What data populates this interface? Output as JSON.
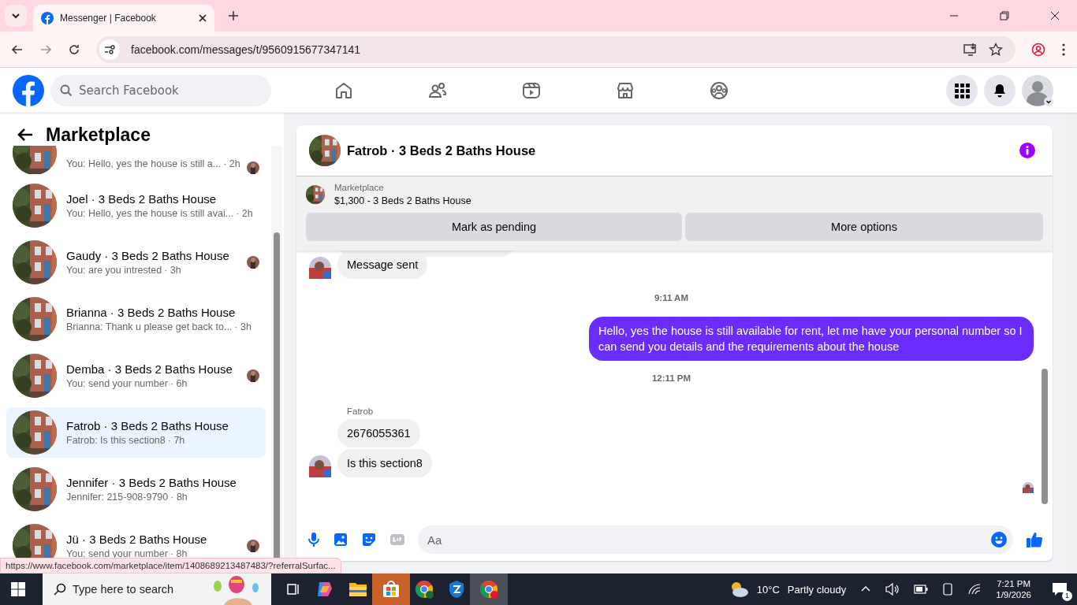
{
  "browser": {
    "tab_title": "Messenger | Facebook",
    "url": "facebook.com/messages/t/9560915677347141",
    "status_url": "https://www.facebook.com/marketplace/item/1408689213487483/?referralSurfac..."
  },
  "topbar": {
    "search": {
      "placeholder": "Search Facebook"
    }
  },
  "sidebar": {
    "title": "Marketplace",
    "conversations": [
      {
        "kind": "partial",
        "preview": "You: Hello, yes the house is still a...",
        "time": "· 2h",
        "selected": false,
        "seen_avatar": true
      },
      {
        "kind": "full",
        "name": "Joel · 3 Beds 2 Baths House",
        "preview": "You: Hello, yes the house is still avai...",
        "time": "· 2h",
        "selected": false,
        "seen_avatar": false
      },
      {
        "kind": "full",
        "name": "Gaudy · 3 Beds 2 Baths House",
        "preview": "You: are you intrested",
        "time": "· 3h",
        "selected": false,
        "seen_avatar": true
      },
      {
        "kind": "full",
        "name": "Brianna · 3 Beds 2 Baths House",
        "preview": "Brianna: Thank u please get back to...",
        "time": "· 3h",
        "selected": false,
        "seen_avatar": false
      },
      {
        "kind": "full",
        "name": "Demba · 3 Beds 2 Baths House",
        "preview": "You: send your number",
        "time": "· 6h",
        "selected": false,
        "seen_avatar": true
      },
      {
        "kind": "full",
        "name": "Fatrob · 3 Beds 2 Baths House",
        "preview": "Fatrob: Is this section8",
        "time": "· 7h",
        "selected": true,
        "seen_avatar": false
      },
      {
        "kind": "full",
        "name": "Jennifer · 3 Beds 2 Baths House",
        "preview": "Jennifer: 215-908-9790",
        "time": "· 8h",
        "selected": false,
        "seen_avatar": false
      },
      {
        "kind": "full",
        "name": "Jü · 3 Beds 2 Baths House",
        "preview": "You: send your number",
        "time": "· 8h",
        "selected": false,
        "seen_avatar": true
      }
    ]
  },
  "chat": {
    "title": "Fatrob · 3 Beds 2 Baths House",
    "listing": {
      "label": "Marketplace",
      "title": "$1,300 - 3 Beds 2 Baths House"
    },
    "actions": [
      "Mark as pending",
      "More options"
    ],
    "messages": [
      {
        "kind": "incoming",
        "text": "Message sent",
        "avatar": true
      },
      {
        "kind": "time",
        "text": "9:11 AM"
      },
      {
        "kind": "outgoing",
        "text": "Hello, yes the house is still available for rent, let me have your personal number so I can send you details and the requirements about the house"
      },
      {
        "kind": "time",
        "text": "12:11 PM"
      },
      {
        "kind": "sender",
        "text": "Fatrob"
      },
      {
        "kind": "incoming",
        "text": "2676055361",
        "avatar": false
      },
      {
        "kind": "incoming",
        "text": "Is this section8",
        "avatar": true
      }
    ],
    "composer": {
      "placeholder": "Aa"
    }
  },
  "taskbar": {
    "search": {
      "placeholder": "Type here to search"
    },
    "weather": {
      "temp": "10°C",
      "condition": "Partly cloudy"
    },
    "time": "7:21 PM",
    "date": "1/9/2026",
    "notifications": "1"
  }
}
